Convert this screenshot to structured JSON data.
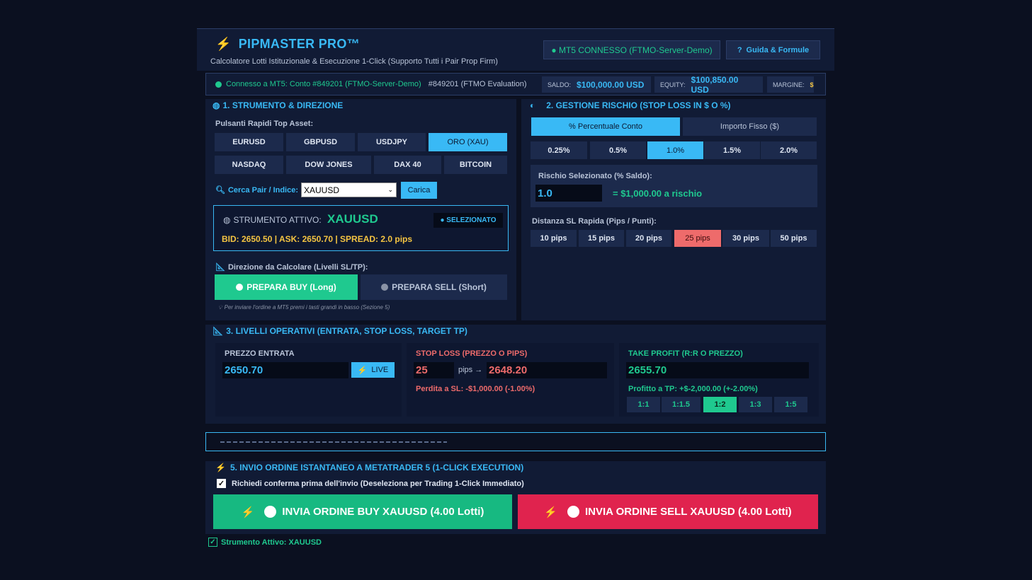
{
  "header": {
    "title": "PIPMASTER PRO™",
    "subtitle": "Calcolatore Lotti Istituzionale & Esecuzione 1-Click (Supporto Tutti i Pair Prop Firm)",
    "mt5_status": "● MT5 CONNESSO (FTMO-Server-Demo)",
    "guide_label": "Guida & Formule"
  },
  "connection": {
    "status": "Connesso a MT5: Conto #849201 (FTMO-Server-Demo)",
    "account": "#849201 (FTMO Evaluation)",
    "saldo_label": "SALDO:",
    "saldo_value": "$100,000.00 USD",
    "equity_label": "EQUITY:",
    "equity_value": "$100,850.00 USD",
    "margine_label": "MARGINE:",
    "margine_value": "$"
  },
  "section1": {
    "title": "1. STRUMENTO & DIREZIONE",
    "quick_label": "Pulsanti Rapidi Top Asset:",
    "assets_row1": [
      "EURUSD",
      "GBPUSD",
      "USDJPY",
      "ORO (XAU)"
    ],
    "assets_row2": [
      "NASDAQ",
      "DOW JONES",
      "DAX 40",
      "BITCOIN"
    ],
    "search_label": "Cerca Pair / Indice:",
    "search_value": "XAUUSD",
    "load_label": "Carica",
    "active_label": "STRUMENTO ATTIVO:",
    "active_symbol": "XAUUSD",
    "selected_badge": "● SELEZIONATO",
    "quote": "BID: 2650.50 | ASK: 2650.70 | SPREAD: 2.0 pips",
    "direction_label": "Direzione da Calcolare (Livelli SL/TP):",
    "buy_label": "PREPARA BUY (Long)",
    "sell_label": "PREPARA SELL (Short)",
    "hint": "Per inviare l'ordine a MT5 premi i tasti grandi in basso (Sezione 5)"
  },
  "section2": {
    "title": "2. GESTIONE RISCHIO (STOP LOSS IN $ O %)",
    "tab_percent": "% Percentuale Conto",
    "tab_fixed": "Importo Fisso ($)",
    "risk_options": [
      "0.25%",
      "0.5%",
      "1.0%",
      "1.5%",
      "2.0%"
    ],
    "risk_selected_label": "Rischio Selezionato (% Saldo):",
    "risk_value": "1.0",
    "risk_amount": "= $1,000.00 a rischio",
    "sl_label": "Distanza SL Rapida (Pips / Punti):",
    "sl_options": [
      "10 pips",
      "15 pips",
      "20 pips",
      "25 pips",
      "30 pips",
      "50 pips"
    ]
  },
  "section3": {
    "title": "3. LIVELLI OPERATIVI (ENTRATA, STOP LOSS, TARGET TP)",
    "entry_label": "PREZZO ENTRATA",
    "entry_value": "2650.70",
    "live_label": "LIVE",
    "sl_label": "STOP LOSS (PREZZO O PIPS)",
    "sl_pips": "25",
    "pips_arrow": "pips →",
    "sl_price": "2648.20",
    "sl_loss": "Perdita a SL: -$1,000.00 (-1.00%)",
    "tp_label": "TAKE PROFIT (R:R O PREZZO)",
    "tp_value": "2655.70",
    "tp_profit": "Profitto a TP: +$-2,000.00 (+-2.00%)",
    "rr_options": [
      "1:1",
      "1:1.5",
      "1:2",
      "1:3",
      "1:5"
    ]
  },
  "section5": {
    "title": "5. INVIO ORDINE ISTANTANEO A METATRADER 5 (1-CLICK EXECUTION)",
    "confirm_label": "Richiedi conferma prima dell'invio (Deseleziona per Trading 1-Click Immediato)",
    "buy_order": "INVIA ORDINE BUY XAUUSD (4.00 Lotti)",
    "sell_order": "INVIA ORDINE SELL XAUUSD (4.00 Lotti)",
    "footer": "Strumento Attivo: XAUUSD"
  },
  "colors": {
    "accent": "#39b9f5",
    "green": "#1fc98f",
    "red": "#e0234e",
    "gold": "#f5c542"
  }
}
